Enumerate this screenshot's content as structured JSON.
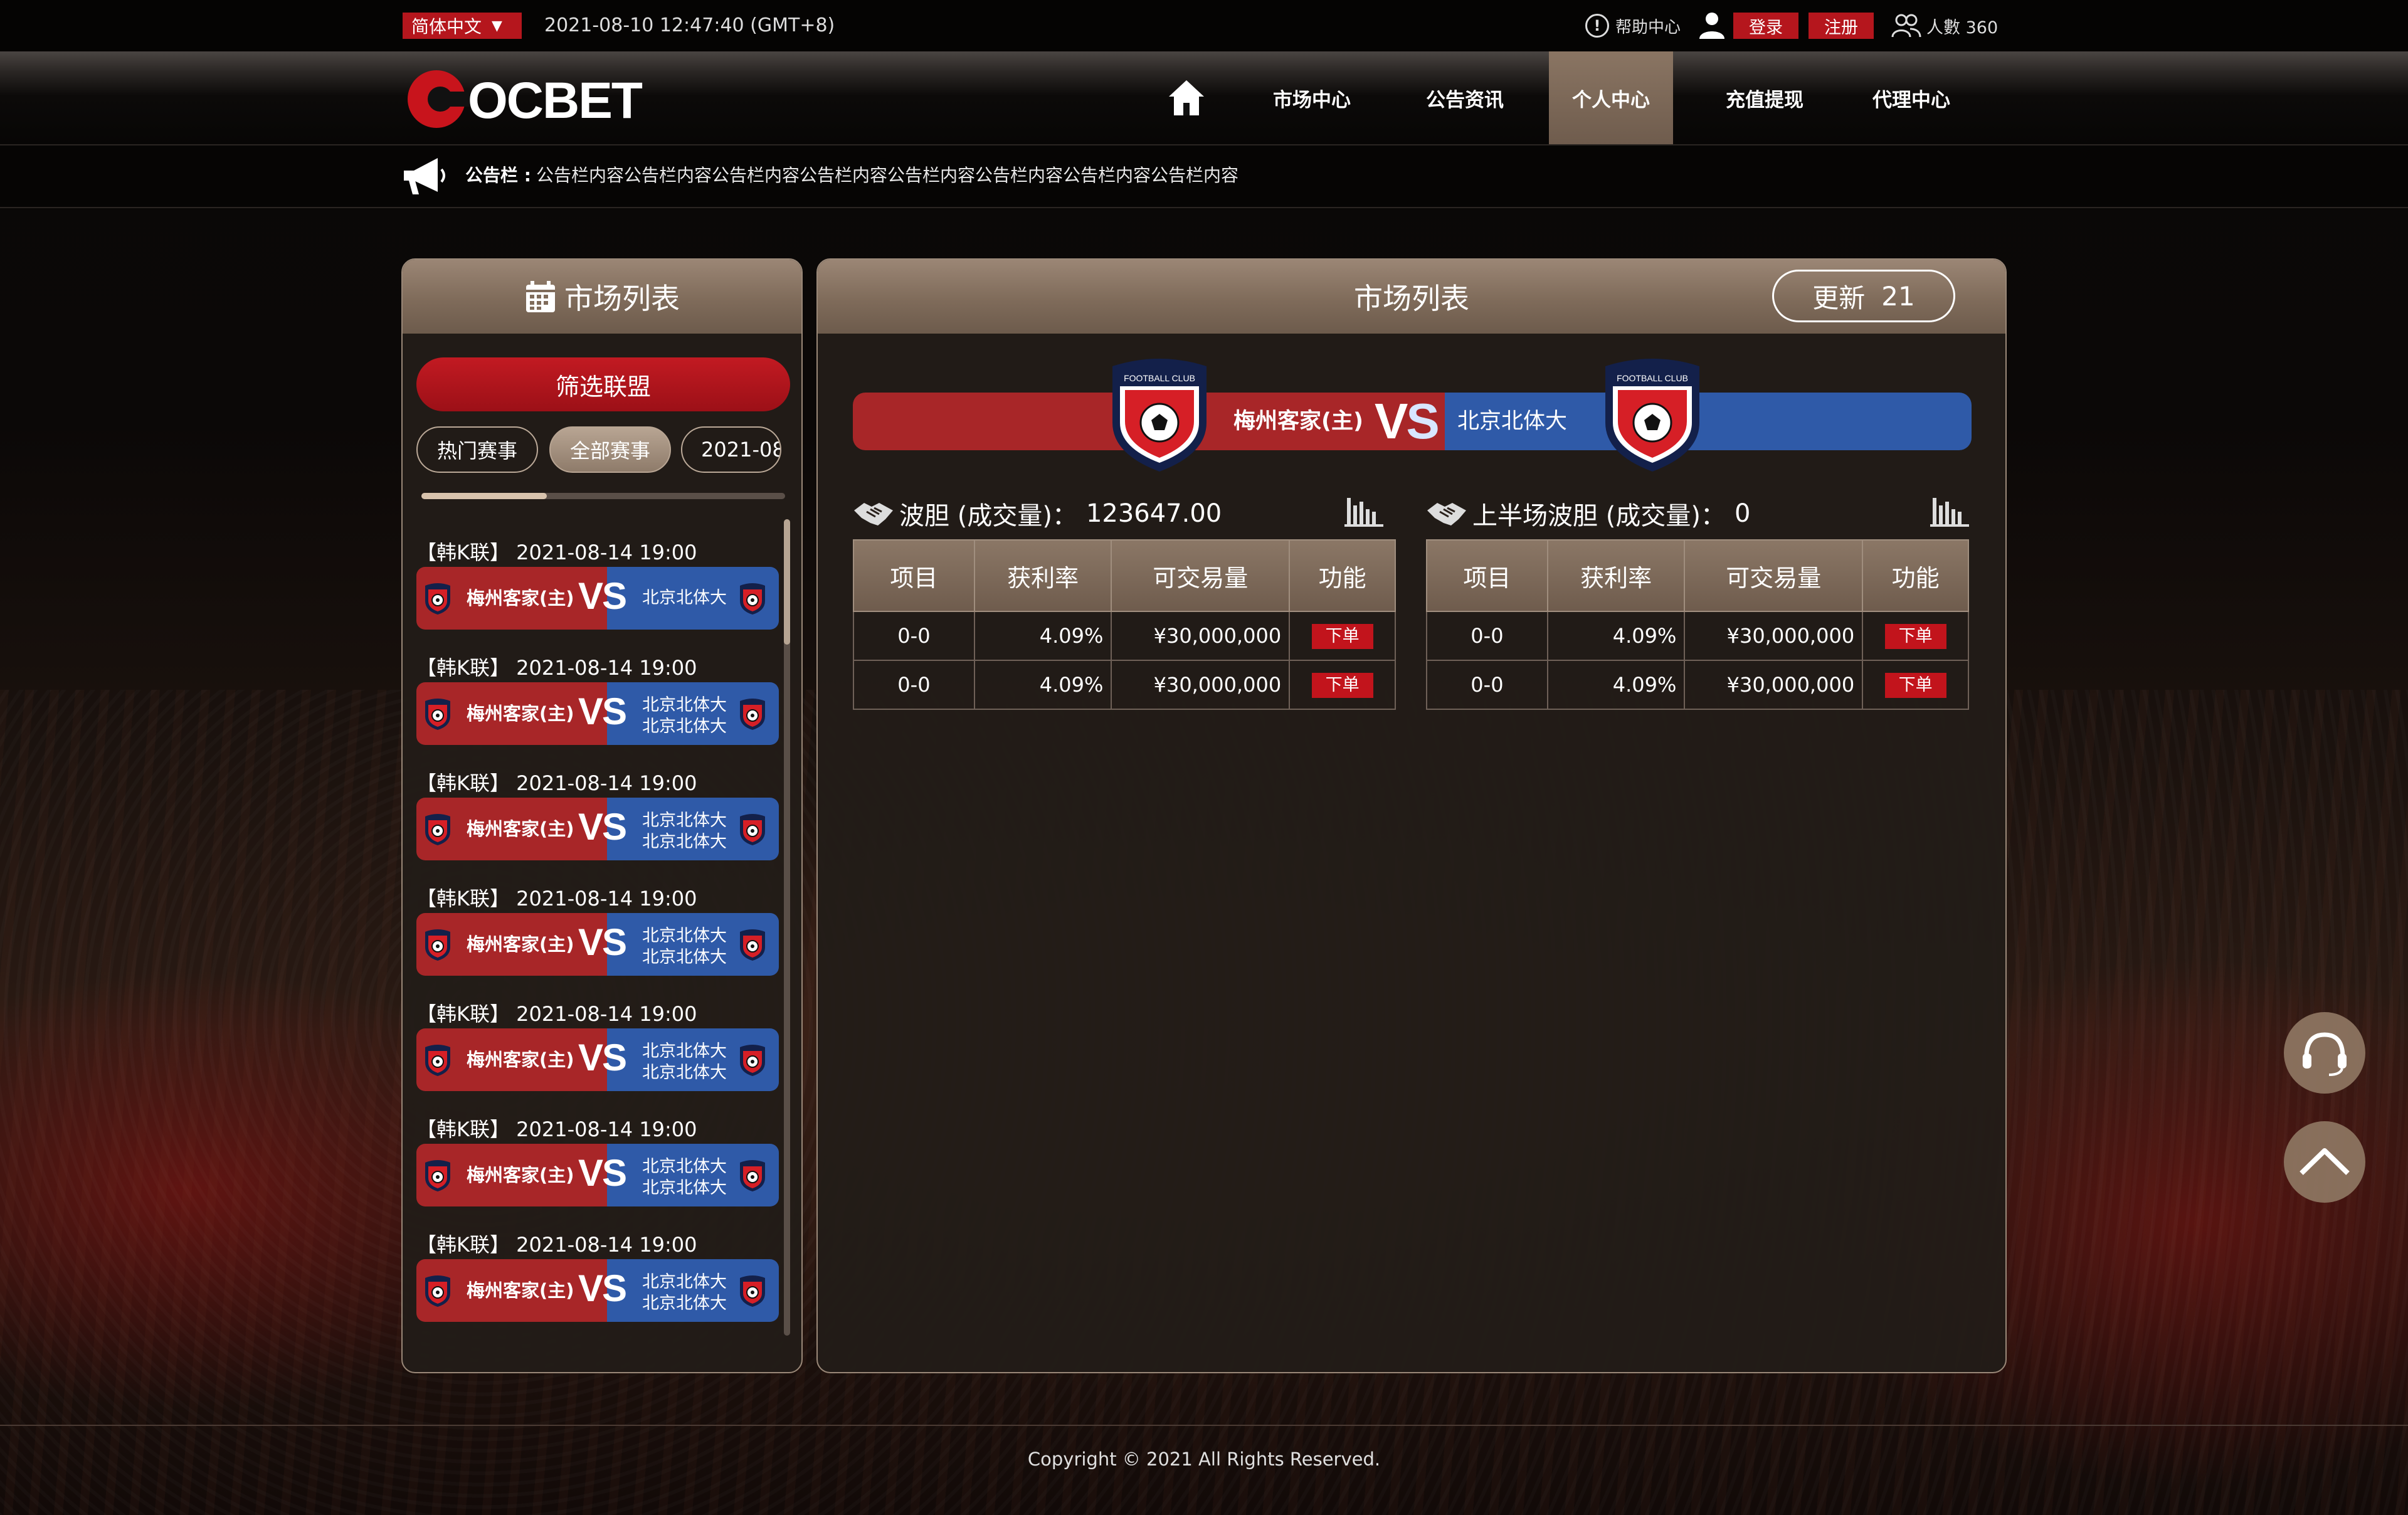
{
  "topbar": {
    "language": "简体中文",
    "datetime": "2021-08-10 12:47:40 (GMT+8)",
    "help": "帮助中心",
    "login": "登录",
    "register": "注册",
    "online": "人數 360"
  },
  "nav": {
    "brand": "COCBET",
    "items": [
      "市场中心",
      "公告资讯",
      "个人中心",
      "充值提现",
      "代理中心"
    ],
    "active": "个人中心"
  },
  "notice": {
    "label": "公告栏 :",
    "text": "公告栏内容公告栏内容公告栏内容公告栏内容公告栏内容公告栏内容公告栏内容公告栏内容"
  },
  "left": {
    "title": "市场列表",
    "filter": "筛选联盟",
    "tabs": [
      "热门赛事",
      "全部赛事",
      "2021-08"
    ],
    "matches": [
      {
        "title": "【韩K联】 2021-08-14 19:00",
        "home": "梅州客家(主)",
        "vs": "VS",
        "away": [
          "北京北体大"
        ]
      },
      {
        "title": "【韩K联】 2021-08-14 19:00",
        "home": "梅州客家(主)",
        "vs": "VS",
        "away": [
          "北京北体大",
          "北京北体大"
        ]
      },
      {
        "title": "【韩K联】 2021-08-14 19:00",
        "home": "梅州客家(主)",
        "vs": "VS",
        "away": [
          "北京北体大",
          "北京北体大"
        ]
      },
      {
        "title": "【韩K联】 2021-08-14 19:00",
        "home": "梅州客家(主)",
        "vs": "VS",
        "away": [
          "北京北体大",
          "北京北体大"
        ]
      },
      {
        "title": "【韩K联】 2021-08-14 19:00",
        "home": "梅州客家(主)",
        "vs": "VS",
        "away": [
          "北京北体大",
          "北京北体大"
        ]
      },
      {
        "title": "【韩K联】 2021-08-14 19:00",
        "home": "梅州客家(主)",
        "vs": "VS",
        "away": [
          "北京北体大",
          "北京北体大"
        ]
      },
      {
        "title": "【韩K联】 2021-08-14 19:00",
        "home": "梅州客家(主)",
        "vs": "VS",
        "away": [
          "北京北体大",
          "北京北体大"
        ]
      }
    ]
  },
  "main": {
    "title": "市场列表",
    "refresh": {
      "label": "更新",
      "count": "21"
    },
    "match": {
      "home": "梅州客家(主)",
      "vs_v": "V",
      "vs_s": "S",
      "away": "北京北体大",
      "crest_text": "FOOTBALL CLUB"
    },
    "sections": [
      {
        "title": "波胆 (成交量)：",
        "volume": "123647.00",
        "columns": [
          "项目",
          "获利率",
          "可交易量",
          "功能"
        ],
        "rows": [
          {
            "item": "0-0",
            "rate": "4.09%",
            "volume": "¥30,000,000",
            "action": "下单"
          },
          {
            "item": "0-0",
            "rate": "4.09%",
            "volume": "¥30,000,000",
            "action": "下单"
          }
        ]
      },
      {
        "title": "上半场波胆 (成交量)：",
        "volume": "0",
        "columns": [
          "项目",
          "获利率",
          "可交易量",
          "功能"
        ],
        "rows": [
          {
            "item": "0-0",
            "rate": "4.09%",
            "volume": "¥30,000,000",
            "action": "下单"
          },
          {
            "item": "0-0",
            "rate": "4.09%",
            "volume": "¥30,000,000",
            "action": "下单"
          }
        ]
      }
    ]
  },
  "footer": {
    "copyright": "Copyright © 2021 All Rights Reserved."
  },
  "colors": {
    "accent_red": "#b5161d",
    "home_red": "#a82628",
    "away_blue": "#2f5aa8",
    "gold_brown": "#8b7766"
  }
}
